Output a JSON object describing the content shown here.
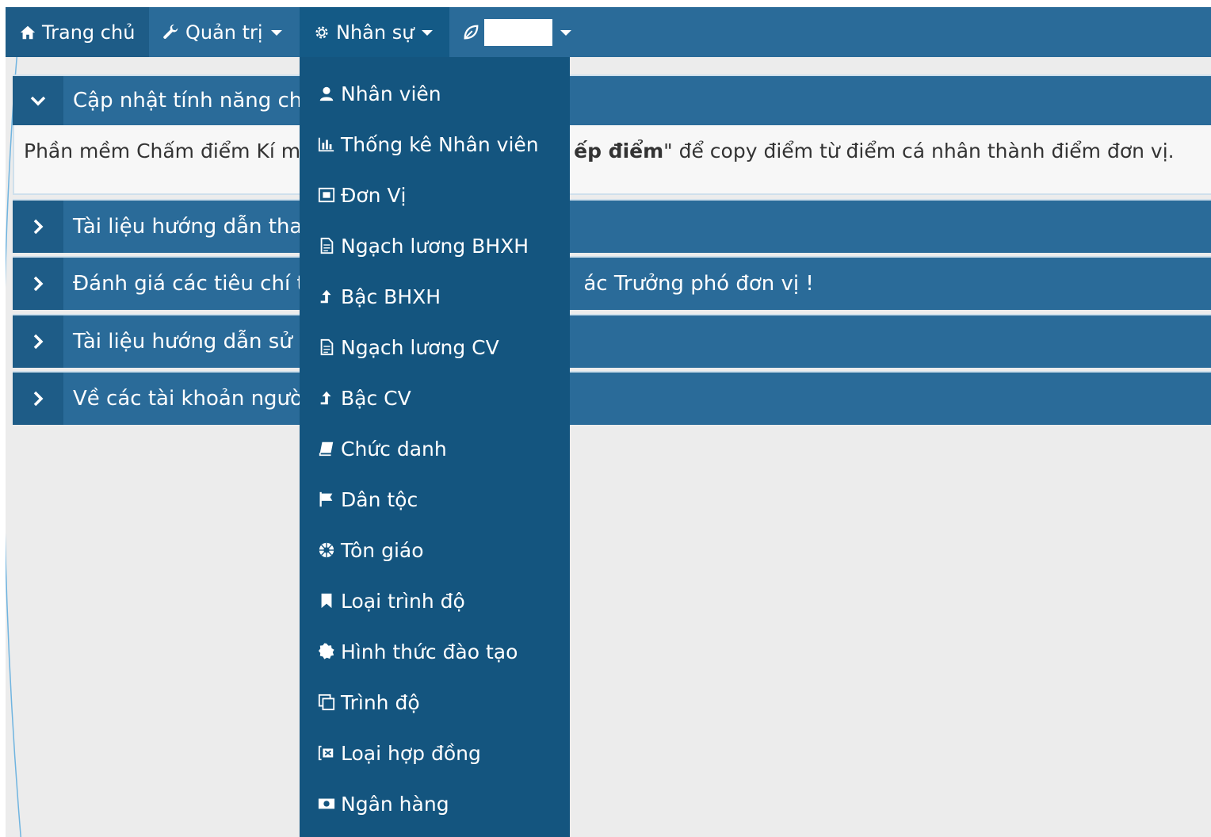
{
  "colors": {
    "navbar": "#2a6b99",
    "nav_active": "#14557f",
    "dropdown_bg": "#14557f",
    "panel_head": "#2a6b99",
    "panel_toggle": "#1e5c87",
    "page_bg": "#ececec"
  },
  "navbar": {
    "items": [
      {
        "label": "Trang chủ",
        "icon": "home-icon"
      },
      {
        "label": "Quản trị",
        "icon": "wrench-icon"
      },
      {
        "label": "Nhân sự",
        "icon": "gear-icon"
      },
      {
        "label": "",
        "icon": "leaf-icon"
      }
    ]
  },
  "panels": [
    {
      "title": "Cập nhật tính năng chấ",
      "expanded": true,
      "body_prefix": "Phần mềm Chấm điểm Kí m",
      "body_bold": "ếp điểm",
      "body_suffix": "\" để copy điểm từ điểm cá nhân thành điểm đơn vị."
    },
    {
      "title": "Tài liệu hướng dẫn thay",
      "expanded": false
    },
    {
      "title": "Đánh giá các tiêu chí tr",
      "title_tail": "ác Trưởng phó đơn vị !",
      "expanded": false
    },
    {
      "title": "Tài liệu hướng dẫn sử c",
      "expanded": false
    },
    {
      "title": "Về các tài khoản người",
      "expanded": false
    }
  ],
  "dropdown": {
    "items": [
      {
        "label": "Nhân viên",
        "icon": "user-icon"
      },
      {
        "label": "Thống kê Nhân viên",
        "icon": "bar-chart-icon"
      },
      {
        "label": "Đơn Vị",
        "icon": "org-icon"
      },
      {
        "label": "Ngạch lương BHXH",
        "icon": "document-icon"
      },
      {
        "label": "Bậc BHXH",
        "icon": "level-up-icon"
      },
      {
        "label": "Ngạch lương CV",
        "icon": "document-icon"
      },
      {
        "label": "Bậc CV",
        "icon": "level-up-icon"
      },
      {
        "label": "Chức danh",
        "icon": "book-icon"
      },
      {
        "label": "Dân tộc",
        "icon": "flag-icon"
      },
      {
        "label": "Tôn giáo",
        "icon": "wheel-icon"
      },
      {
        "label": "Loại trình độ",
        "icon": "bookmark-icon"
      },
      {
        "label": "Hình thức đào tạo",
        "icon": "certificate-icon"
      },
      {
        "label": "Trình độ",
        "icon": "copy-icon"
      },
      {
        "label": "Loại hợp đồng",
        "icon": "contract-icon"
      },
      {
        "label": "Ngân hàng",
        "icon": "money-icon"
      }
    ]
  }
}
